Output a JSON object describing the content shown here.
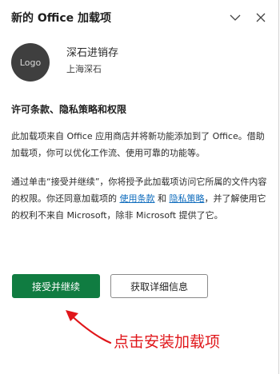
{
  "header": {
    "title": "新的 Office 加载项",
    "collapse_icon": "chevron-down-icon",
    "close_icon": "close-icon"
  },
  "app": {
    "logo_text": "Logo",
    "name": "深石进销存",
    "publisher": "上海深石"
  },
  "terms": {
    "heading": "许可条款、隐私策略和权限",
    "para1": "此加载项来自 Office 应用商店并将新功能添加到了 Office。借助加载项，你可以优化工作流、使用可靠的功能等。",
    "para2_part1": "通过单击“接受并继续”，你将授予此加载项访问它所属的文件内容的权限。你还同意加载项的 ",
    "link_terms": "使用条款",
    "para2_part2": " 和 ",
    "link_privacy": "隐私策略",
    "para2_part3": "，并了解使用它的权利不来自 Microsoft，除非 Microsoft 提供了它。"
  },
  "actions": {
    "accept_label": "接受并继续",
    "details_label": "获取详细信息"
  },
  "annotation": {
    "text": "点击安装加载项",
    "color": "#e0161a"
  },
  "colors": {
    "accent": "#107c41",
    "link": "#0f6cbd"
  }
}
